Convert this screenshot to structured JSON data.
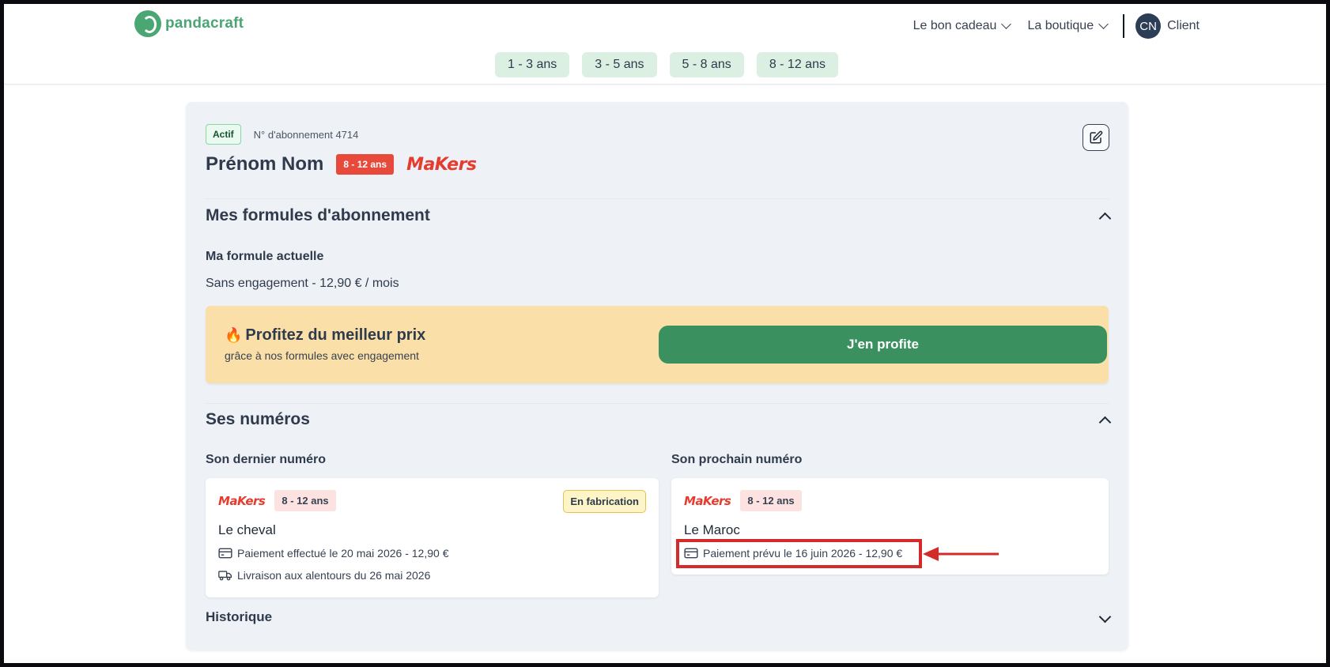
{
  "header": {
    "brand": "pandacraft",
    "nav": [
      "Le bon cadeau",
      "La boutique"
    ],
    "avatar_initials": "CN",
    "client_label": "Client",
    "age_tabs": [
      "1 - 3 ans",
      "3 - 5 ans",
      "5 - 8 ans",
      "8 - 12 ans"
    ]
  },
  "subscription": {
    "status": "Actif",
    "number_label": "N° d'abonnement 4714",
    "name": "Prénom Nom",
    "age_badge": "8 - 12 ans",
    "brand": "MaKers"
  },
  "formules": {
    "title": "Mes formules d'abonnement",
    "current_heading": "Ma formule actuelle",
    "current_value": "Sans engagement - 12,90 € / mois",
    "promo_title": "Profitez du meilleur prix",
    "promo_subtitle": "grâce à nos formules avec engagement",
    "promo_button": "J'en profite"
  },
  "numeros": {
    "title": "Ses numéros",
    "last_heading": "Son dernier numéro",
    "next_heading": "Son prochain numéro",
    "last": {
      "brand": "MaKers",
      "age": "8 - 12 ans",
      "status": "En fabrication",
      "title": "Le cheval",
      "payment": "Paiement effectué le 20 mai 2026 - 12,90 €",
      "delivery": "Livraison aux alentours du 26 mai 2026"
    },
    "next": {
      "brand": "MaKers",
      "age": "8 - 12 ans",
      "title": "Le Maroc",
      "payment": "Paiement prévu le 16 juin 2026 - 12,90 €"
    }
  },
  "historique": {
    "title": "Historique"
  },
  "colors": {
    "brand_green": "#4aa673",
    "button_green": "#3a915f",
    "promo_bg": "#fae0a8",
    "makers_red": "#e63b2e",
    "annotation_red": "#d42a2a"
  }
}
